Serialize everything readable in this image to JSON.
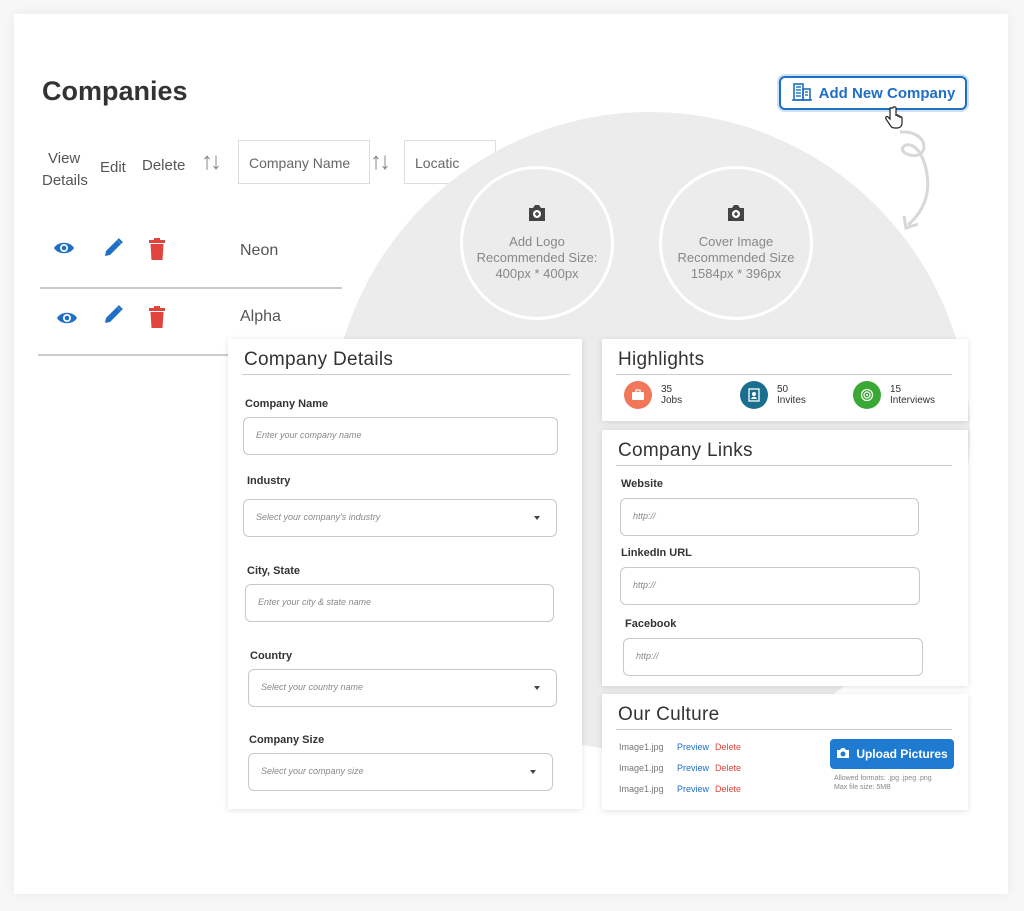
{
  "page": {
    "title": "Companies"
  },
  "add_button": {
    "label": "Add New Company"
  },
  "table": {
    "headers": {
      "view_line1": "View",
      "view_line2": "Details",
      "edit": "Edit",
      "delete": "Delete"
    },
    "filters": {
      "company_name": "Company Name",
      "location": "Locatic"
    },
    "rows": [
      {
        "name": "Neon"
      },
      {
        "name": "Alpha"
      }
    ]
  },
  "uploads": {
    "logo": {
      "title": "Add Logo",
      "line2": "Recommended Size:",
      "line3": "400px * 400px"
    },
    "cover": {
      "title": "Cover Image",
      "line2": "Recommended Size",
      "line3": "1584px * 396px"
    }
  },
  "company_details": {
    "title": "Company Details",
    "fields": [
      {
        "label": "Company Name",
        "placeholder": "Enter your company name"
      },
      {
        "label": "Industry",
        "placeholder": "Select your company's industry"
      },
      {
        "label": "City, State",
        "placeholder": "Enter your city & state name"
      },
      {
        "label": "Country",
        "placeholder": "Select your country name"
      },
      {
        "label": "Company Size",
        "placeholder": "Select your company size"
      }
    ]
  },
  "highlights": {
    "title": "Highlights",
    "items": [
      {
        "count": "35",
        "label": "Jobs",
        "icon": "briefcase-icon",
        "color": "#f0775a"
      },
      {
        "count": "50",
        "label": "Invites",
        "icon": "contact-book-icon",
        "color": "#1a6f8f"
      },
      {
        "count": "15",
        "label": "Interviews",
        "icon": "target-icon",
        "color": "#3aa835"
      }
    ]
  },
  "company_links": {
    "title": "Company Links",
    "fields": [
      {
        "label": "Website",
        "placeholder": "http://"
      },
      {
        "label": "LinkedIn URL",
        "placeholder": "http://"
      },
      {
        "label": "Facebook",
        "placeholder": "http://"
      }
    ]
  },
  "culture": {
    "title": "Our Culture",
    "files": [
      {
        "name": "Image1.jpg",
        "preview": "Preview",
        "delete": "Delete"
      },
      {
        "name": "Image1.jpg",
        "preview": "Preview",
        "delete": "Delete"
      },
      {
        "name": "Image1.jpg",
        "preview": "Preview",
        "delete": "Delete"
      }
    ],
    "upload_label": "Upload Pictures",
    "note_line1": "Allowed formats: .jpg .jpeg .png",
    "note_line2": "Max file size: 5MB"
  },
  "colors": {
    "primary": "#1f6fc5",
    "delete": "#e0443c"
  }
}
